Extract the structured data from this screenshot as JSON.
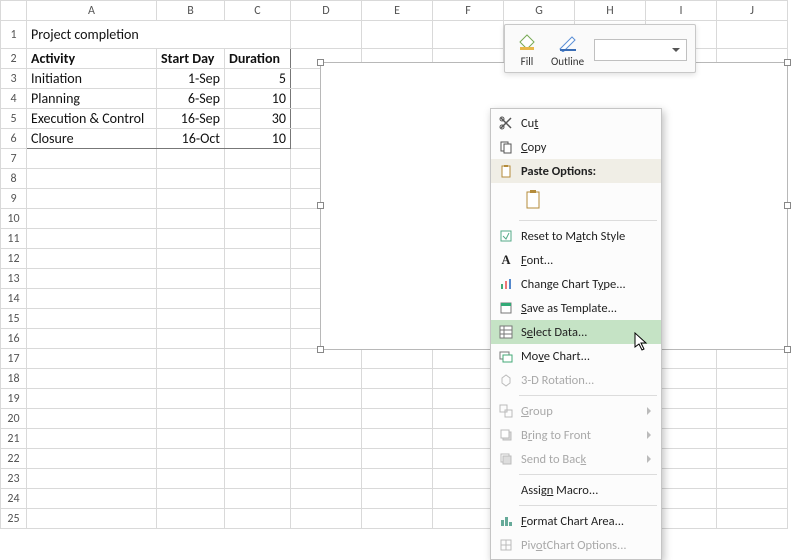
{
  "columns": [
    "A",
    "B",
    "C",
    "D",
    "E",
    "F",
    "G",
    "H",
    "I",
    "J"
  ],
  "rows_visible": 25,
  "sheet": {
    "title": "Project completion",
    "headers": {
      "activity": "Activity",
      "start": "Start Day",
      "duration": "Duration"
    },
    "data": [
      {
        "activity": "Initiation",
        "start": "1-Sep",
        "duration": "5"
      },
      {
        "activity": "Planning",
        "start": "6-Sep",
        "duration": "10"
      },
      {
        "activity": "Execution & Control",
        "start": "16-Sep",
        "duration": "30"
      },
      {
        "activity": "Closure",
        "start": "16-Oct",
        "duration": "10"
      }
    ]
  },
  "mini_toolbar": {
    "fill": "Fill",
    "outline": "Outline"
  },
  "context_menu": {
    "cut": "Cut",
    "copy": "Copy",
    "paste_options": "Paste Options:",
    "reset": "Reset to Match Style",
    "font": "Font...",
    "change_type": "Change Chart Type...",
    "save_template": "Save as Template...",
    "select_data": "Select Data...",
    "move_chart": "Move Chart...",
    "rotation_3d": "3-D Rotation...",
    "group": "Group",
    "bring_front": "Bring to Front",
    "send_back": "Send to Back",
    "assign_macro": "Assign Macro...",
    "format_area": "Format Chart Area...",
    "pivot_opts": "PivotChart Options..."
  }
}
